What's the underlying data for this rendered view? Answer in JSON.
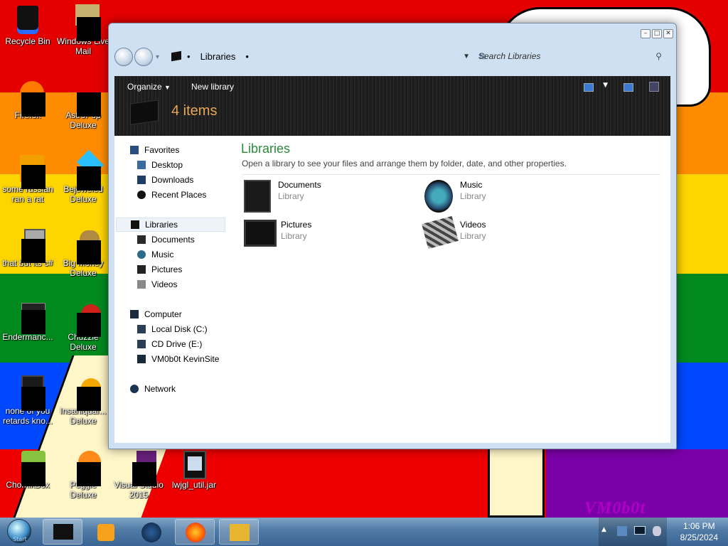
{
  "desktop": {
    "icons": [
      {
        "label": "Recycle Bin"
      },
      {
        "label": "Windows Live Mail"
      },
      {
        "label": "Firefox"
      },
      {
        "label": "AstroPop Deluxe"
      },
      {
        "label": "some russian ran a rat"
      },
      {
        "label": "Bejeweled Deluxe"
      },
      {
        "label": "that but its c#"
      },
      {
        "label": "Big Money Deluxe"
      },
      {
        "label": "Endermanc..."
      },
      {
        "label": "Chuzzle Deluxe"
      },
      {
        "label": "none of you retards kno..."
      },
      {
        "label": "Insaniquar... Deluxe"
      },
      {
        "label": "ChomikBox"
      },
      {
        "label": "Peggle Deluxe"
      },
      {
        "label": "Visual Studio 2015"
      },
      {
        "label": "lwjgl_util.jar"
      }
    ],
    "wallpaper_text": "VM0b0t"
  },
  "window": {
    "address": {
      "location": "Libraries"
    },
    "search_placeholder": "Search Libraries",
    "toolbar": {
      "organize": "Organize",
      "new_library": "New library"
    },
    "item_count": "4 items",
    "nav": {
      "favorites": "Favorites",
      "desktop": "Desktop",
      "downloads": "Downloads",
      "recent_places": "Recent Places",
      "libraries": "Libraries",
      "documents": "Documents",
      "music": "Music",
      "pictures": "Pictures",
      "videos": "Videos",
      "computer": "Computer",
      "local_disk": "Local Disk (C:)",
      "cd_drive": "CD Drive (E:)",
      "network_drive": "VM0b0t KevinSite",
      "network": "Network"
    },
    "main": {
      "heading": "Libraries",
      "description": "Open a library to see your files and arrange them by folder, date, and other properties.",
      "libraries": [
        {
          "name": "Documents",
          "type": "Library"
        },
        {
          "name": "Music",
          "type": "Library"
        },
        {
          "name": "Pictures",
          "type": "Library"
        },
        {
          "name": "Videos",
          "type": "Library"
        }
      ]
    }
  },
  "taskbar": {
    "start_label": "Start",
    "clock": {
      "time": "1:06 PM",
      "date": "8/25/2024"
    }
  },
  "colors": {
    "heading": "#2a8a3a",
    "item_count": "#e8a657",
    "taskbar": "#4f7aa5"
  }
}
